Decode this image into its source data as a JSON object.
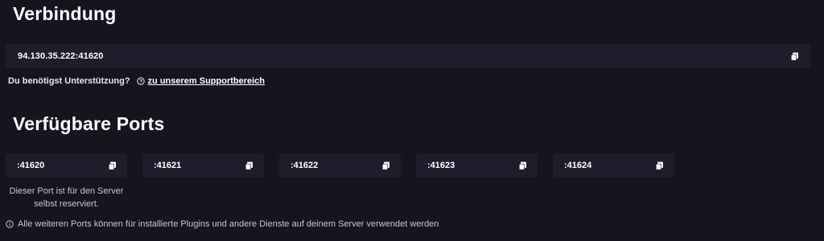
{
  "connection": {
    "title": "Verbindung",
    "address": "94.130.35.222:41620",
    "copy_icon": "copy-icon"
  },
  "support": {
    "question": "Du benötigst Unterstützung?",
    "link_text": "zu unserem Supportbereich",
    "icon": "help-circle-icon"
  },
  "ports": {
    "title": "Verfügbare Ports",
    "items": [
      {
        "value": ":41620",
        "note": "Dieser Port ist für den Server selbst reserviert."
      },
      {
        "value": ":41621",
        "note": ""
      },
      {
        "value": ":41622",
        "note": ""
      },
      {
        "value": ":41623",
        "note": ""
      },
      {
        "value": ":41624",
        "note": ""
      }
    ]
  },
  "footer": {
    "icon": "info-circle-icon",
    "text": "Alle weiteren Ports können für installierte Plugins und andere Dienste auf deinem Server verwendet werden"
  },
  "colors": {
    "background": "#16141f",
    "box": "#1f1c2c",
    "text": "#ffffff",
    "muted": "#c9c6d3"
  }
}
